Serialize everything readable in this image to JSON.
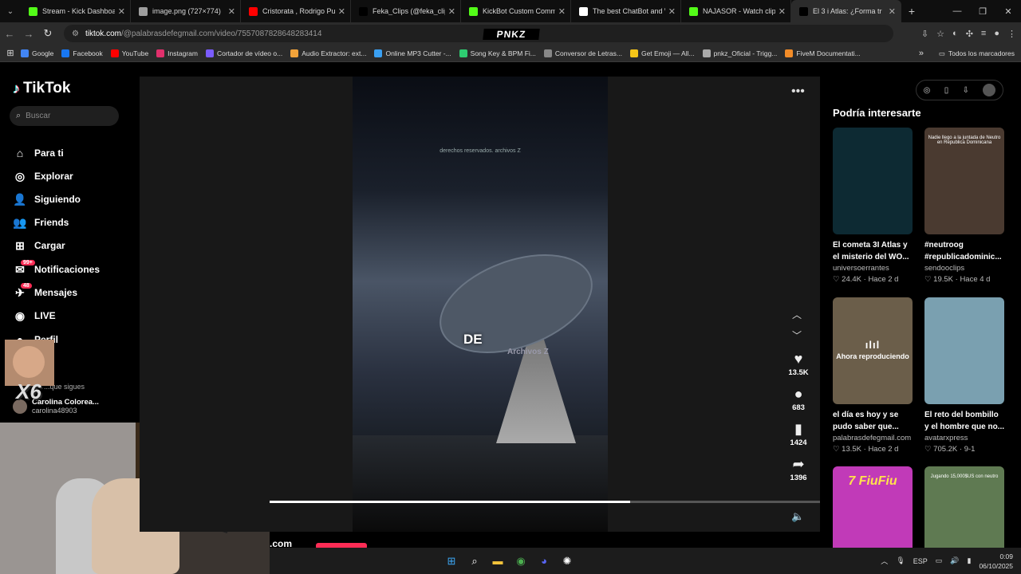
{
  "browser": {
    "tabs": [
      {
        "title": "Stream - Kick Dashboard",
        "color": "#53fc18"
      },
      {
        "title": "image.png (727×774)",
        "color": "#9e9e9e"
      },
      {
        "title": "Cristorata , Rodrigo Puent",
        "color": "#ff0000"
      },
      {
        "title": "Feka_Clips (@feka_clips) |",
        "color": "#000000"
      },
      {
        "title": "KickBot Custom Comman",
        "color": "#53fc18"
      },
      {
        "title": "The best ChatBot and Wi",
        "color": "#ffffff"
      },
      {
        "title": "NAJASOR - Watch clips o",
        "color": "#53fc18"
      },
      {
        "title": "El 3 i Atlas: ¿Forma tr",
        "color": "#000000"
      }
    ],
    "url_host": "tiktok.com",
    "url_path": "/@palabrasdefegmail.com/video/7557087828648283414",
    "overlay_brand": "PNKZ",
    "bookmarks": [
      {
        "label": "Google",
        "color": "#4285f4"
      },
      {
        "label": "Facebook",
        "color": "#1877f2"
      },
      {
        "label": "YouTube",
        "color": "#ff0000"
      },
      {
        "label": "Instagram",
        "color": "#e1306c"
      },
      {
        "label": "Cortador de vídeo o...",
        "color": "#7a5cff"
      },
      {
        "label": "Audio Extractor: ext...",
        "color": "#f2a33a"
      },
      {
        "label": "Online MP3 Cutter -...",
        "color": "#3aa0f2"
      },
      {
        "label": "Song Key & BPM Fi...",
        "color": "#2ecc71"
      },
      {
        "label": "Conversor de Letras...",
        "color": "#888888"
      },
      {
        "label": "Get Emoji — All...",
        "color": "#f5c518"
      },
      {
        "label": "pnkz_Oficial - Trigg...",
        "color": "#aaaaaa"
      },
      {
        "label": "FiveM Documentati...",
        "color": "#f28c28"
      }
    ],
    "all_bookmarks": "Todos los marcadores"
  },
  "sidebar": {
    "logo": "TikTok",
    "search_placeholder": "Buscar",
    "items": [
      {
        "label": "Para ti",
        "icon": "home-icon",
        "glyph": "⌂"
      },
      {
        "label": "Explorar",
        "icon": "compass-icon",
        "glyph": "◎"
      },
      {
        "label": "Siguiendo",
        "icon": "following-icon",
        "glyph": "👤"
      },
      {
        "label": "Friends",
        "icon": "friends-icon",
        "glyph": "👥"
      },
      {
        "label": "Cargar",
        "icon": "upload-icon",
        "glyph": "⊞"
      },
      {
        "label": "Notificaciones",
        "icon": "bell-icon",
        "glyph": "✉",
        "badge": "99+"
      },
      {
        "label": "Mensajes",
        "icon": "message-icon",
        "glyph": "✈",
        "badge": "48"
      },
      {
        "label": "LIVE",
        "icon": "live-icon",
        "glyph": "◉"
      },
      {
        "label": "Perfil",
        "icon": "profile-icon",
        "glyph": "●"
      }
    ],
    "following_title": "...que sigues",
    "follow_user_name": "Carolina Colorea...",
    "follow_user_handle": "carolina48903",
    "overlay_text": "X6"
  },
  "video": {
    "credit": "derechos reservados. archivos Z",
    "caption": "DE",
    "watermark": "Archivos Z",
    "progress": 0.655,
    "likes": "13.5K",
    "comments": "683",
    "saves": "1424",
    "shares": "1396",
    "below_text": ".com"
  },
  "recommendations": {
    "title": "Podría interesarte",
    "items": [
      {
        "title": "El cometa 3I Atlas y el misterio del WO...",
        "author": "universoerrantes",
        "likes": "24.4K",
        "date": "Hace 2 d",
        "bg": "#0d2a33"
      },
      {
        "title": "#neutroog #republicadominic...",
        "author": "sendooclips",
        "likes": "19.5K",
        "date": "Hace 4 d",
        "bg": "#4a3a30",
        "overlay": "Nadie llego a la juntada de Neutro en Republica Dominicana"
      },
      {
        "title": "el día es hoy y se pudo saber que...",
        "author": "palabrasdefegmail.com",
        "likes": "13.5K",
        "date": "Hace 2 d",
        "bg": "#6b5e4a",
        "now_playing": "Ahora reproduciendo"
      },
      {
        "title": "El reto del bombillo y el hombre que no...",
        "author": "avatarxpress",
        "likes": "705.2K",
        "date": "9-1",
        "bg": "#7aa0b0"
      },
      {
        "title": "",
        "author": "",
        "likes": "",
        "date": "",
        "bg": "#c13ab8",
        "overlay": "7 FiuFiu"
      },
      {
        "title": "",
        "author": "",
        "likes": "",
        "date": "",
        "bg": "#5f7a52",
        "overlay": "Jugando 15,000$US con neutro"
      }
    ]
  },
  "taskbar": {
    "language": "ESP",
    "time": "0:09",
    "date": "06/10/2025"
  }
}
